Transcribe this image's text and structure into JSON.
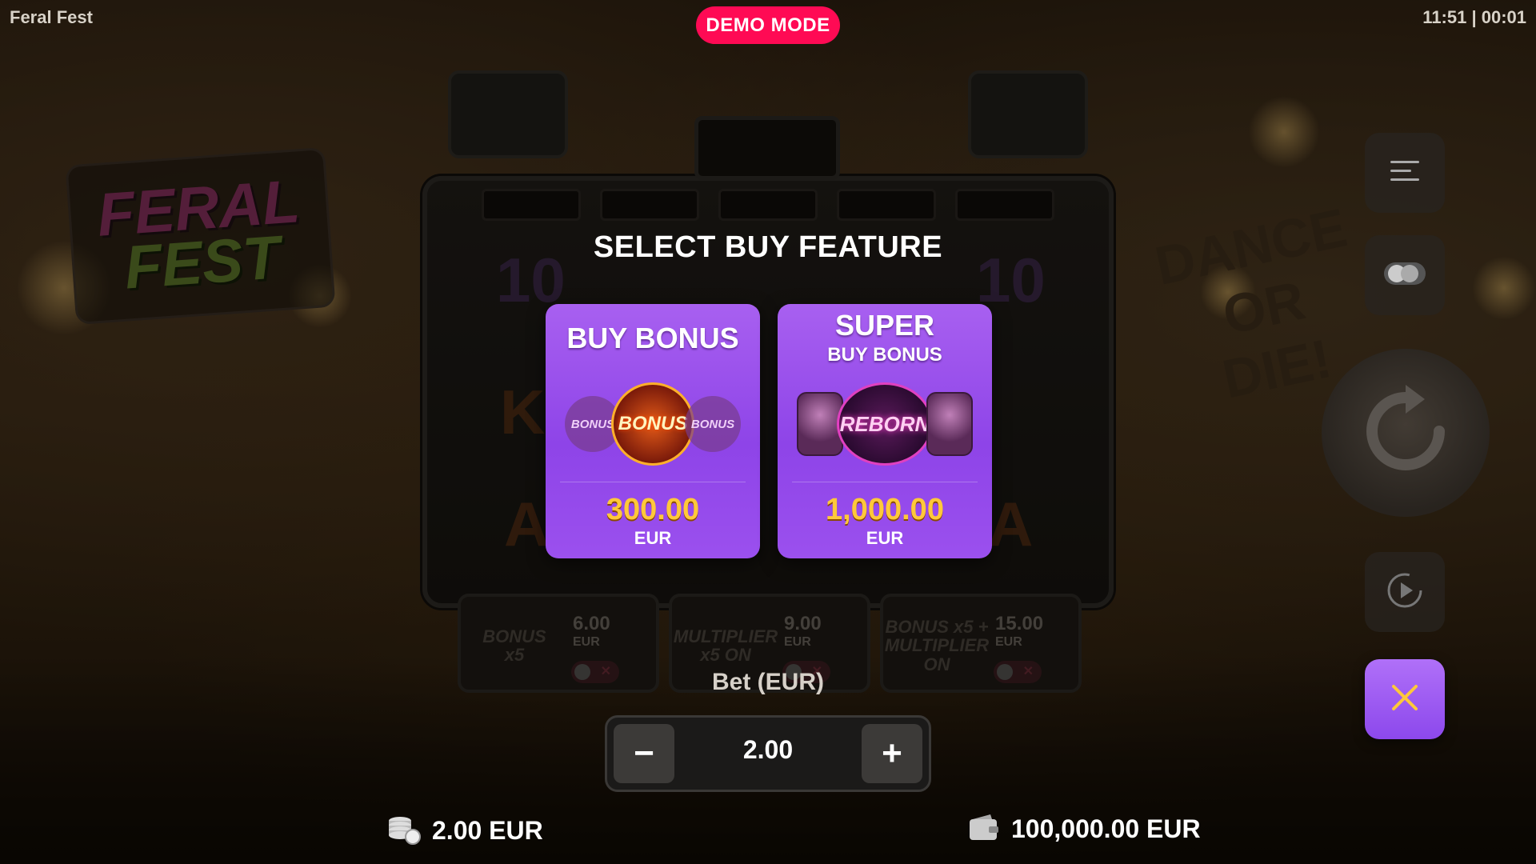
{
  "app": {
    "title": "Feral Fest",
    "clock": "11:51 | 00:01",
    "demo_badge": "DEMO MODE"
  },
  "logo": {
    "line1": "FERAL",
    "line2": "FEST"
  },
  "banner": {
    "line1": "DANCE",
    "line2": "OR",
    "line3": "DIE!"
  },
  "modal": {
    "title": "SELECT BUY FEATURE",
    "cards": [
      {
        "title": "BUY BONUS",
        "subtitle": "",
        "art_main": "BONUS",
        "art_side": "BONUS",
        "price": "300.00",
        "currency": "EUR"
      },
      {
        "title": "SUPER",
        "subtitle": "BUY BONUS",
        "art_main": "REBORN",
        "price": "1,000.00",
        "currency": "EUR"
      }
    ]
  },
  "background_features": [
    {
      "art": "BONUS x5",
      "price": "6.00",
      "currency": "EUR"
    },
    {
      "art": "MULTIPLIER x5 ON",
      "price": "9.00",
      "currency": "EUR"
    },
    {
      "art": "BONUS x5 + MULTIPLIER ON",
      "price": "15.00",
      "currency": "EUR"
    }
  ],
  "bet": {
    "label": "Bet (EUR)",
    "value": "2.00",
    "minus": "−",
    "plus": "+"
  },
  "status": {
    "bet_display": "2.00 EUR",
    "balance": "100,000.00 EUR"
  },
  "icons": {
    "menu": "menu-icon",
    "autoplay": "toggle-icon",
    "spin": "spin-icon",
    "turbo": "replay-icon",
    "close": "close-icon",
    "coins": "coins-icon",
    "wallet": "wallet-icon"
  },
  "colors": {
    "accent": "#9b50ee",
    "demo": "#ff0a54",
    "price": "#ffc83a"
  }
}
